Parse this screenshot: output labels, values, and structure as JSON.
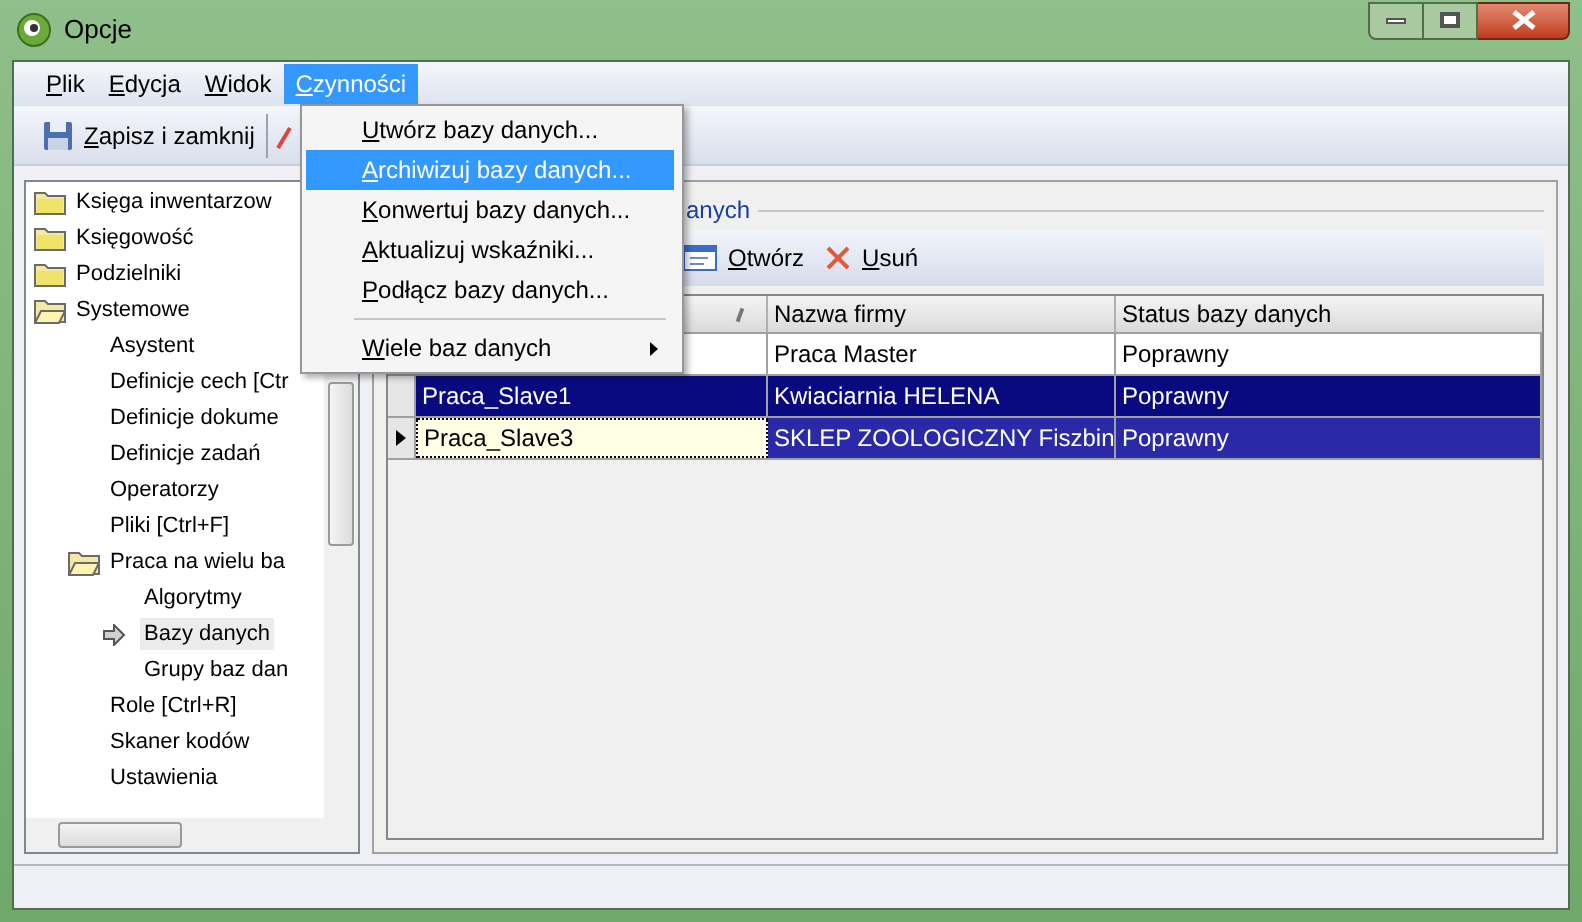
{
  "window": {
    "title": "Opcje"
  },
  "menu_bar": [
    {
      "label": "Plik",
      "selected": false
    },
    {
      "label": "Edycja",
      "selected": false
    },
    {
      "label": "Widok",
      "selected": false
    },
    {
      "label": "Czynności",
      "selected": true
    }
  ],
  "toolbar": {
    "save_button": "Zapisz i zamknij"
  },
  "dropdown": [
    {
      "label": "Utwórz bazy danych...",
      "selected": false,
      "kind": "item"
    },
    {
      "label": "Archiwizuj bazy danych...",
      "selected": true,
      "kind": "item"
    },
    {
      "label": "Konwertuj bazy danych...",
      "selected": false,
      "kind": "item"
    },
    {
      "label": "Aktualizuj wskaźniki...",
      "selected": false,
      "kind": "item"
    },
    {
      "label": "Podłącz bazy danych...",
      "selected": false,
      "kind": "item"
    },
    {
      "kind": "separator"
    },
    {
      "label": "Wiele baz danych",
      "selected": false,
      "kind": "submenu"
    }
  ],
  "tree": [
    {
      "label": "Księga inwentarzow",
      "kind": "folder",
      "expanded": false,
      "selected": false
    },
    {
      "label": "Księgowość",
      "kind": "folder",
      "expanded": false,
      "selected": false
    },
    {
      "label": "Podzielniki",
      "kind": "folder",
      "expanded": false,
      "selected": false
    },
    {
      "label": "Systemowe",
      "kind": "folder",
      "expanded": true,
      "selected": false,
      "children": [
        {
          "label": "Asystent",
          "kind": "leaf",
          "selected": false
        },
        {
          "label": "Definicje cech [Ctr",
          "kind": "leaf",
          "selected": false
        },
        {
          "label": "Definicje dokume",
          "kind": "leaf",
          "selected": false
        },
        {
          "label": "Definicje zadań",
          "kind": "leaf",
          "selected": false
        },
        {
          "label": "Operatorzy",
          "kind": "leaf",
          "selected": false
        },
        {
          "label": "Pliki [Ctrl+F]",
          "kind": "leaf",
          "selected": false
        },
        {
          "label": "Praca na wielu ba",
          "kind": "folder",
          "expanded": true,
          "selected": false,
          "children": [
            {
              "label": "Algorytmy",
              "kind": "leaf",
              "selected": false
            },
            {
              "label": "Bazy danych",
              "kind": "leaf",
              "selected": true
            },
            {
              "label": "Grupy baz dan",
              "kind": "leaf",
              "selected": false
            }
          ]
        },
        {
          "label": "Role [Ctrl+R]",
          "kind": "leaf",
          "selected": false
        },
        {
          "label": "Skaner kodów",
          "kind": "leaf",
          "selected": false
        },
        {
          "label": "Ustawienia",
          "kind": "leaf",
          "selected": false
        }
      ]
    }
  ],
  "group": {
    "title": "anych"
  },
  "grid_toolbar": [
    "Otwórz",
    "Usuń"
  ],
  "table": {
    "columns": [
      "",
      "Nazwa firmy",
      "Status bazy danych"
    ],
    "rows": [
      {
        "cells": [
          "",
          "Praca Master",
          "Poprawny"
        ],
        "selected": false,
        "current": false
      },
      {
        "cells": [
          "Praca_Slave1",
          "Kwiaciarnia HELENA",
          "Poprawny"
        ],
        "selected": true,
        "current": false
      },
      {
        "cells": [
          "Praca_Slave3",
          "SKLEP ZOOLOGICZNY Fiszbin",
          "Poprawny"
        ],
        "selected": true,
        "current": true
      }
    ]
  }
}
